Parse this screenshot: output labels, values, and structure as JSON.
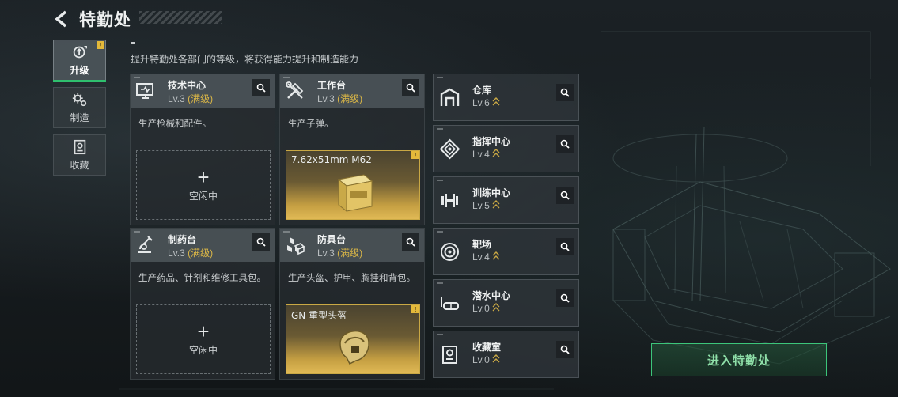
{
  "header": {
    "title": "特勤处"
  },
  "nav": [
    {
      "label": "升级",
      "icon": "upgrade-icon",
      "active": true,
      "badge": "!"
    },
    {
      "label": "制造",
      "icon": "gears-icon",
      "active": false
    },
    {
      "label": "收藏",
      "icon": "collection-icon",
      "active": false
    }
  ],
  "description": "提升特勤处各部门的等级，将获得能力提升和制造能力",
  "cards": [
    {
      "name": "技术中心",
      "level": "Lv.3",
      "max": "(满级)",
      "desc": "生产枪械和配件。",
      "icon": "tech-center-icon",
      "slot": {
        "type": "idle",
        "label": "空闲中"
      }
    },
    {
      "name": "工作台",
      "level": "Lv.3",
      "max": "(满级)",
      "desc": "生产子弹。",
      "icon": "workbench-icon",
      "slot": {
        "type": "item",
        "item": "7.62x51mm M62",
        "badge": "!"
      }
    },
    {
      "name": "制药台",
      "level": "Lv.3",
      "max": "(满级)",
      "desc": "生产药品、针剂和维修工具包。",
      "icon": "pharmacy-icon",
      "slot": {
        "type": "idle",
        "label": "空闲中"
      }
    },
    {
      "name": "防具台",
      "level": "Lv.3",
      "max": "(满级)",
      "desc": "生产头盔、护甲、胸挂和背包。",
      "icon": "armor-bench-icon",
      "slot": {
        "type": "item",
        "item": "GN 重型头盔",
        "badge": "!"
      }
    }
  ],
  "facilities": [
    {
      "name": "仓库",
      "level": "Lv.6",
      "icon": "warehouse-icon"
    },
    {
      "name": "指挥中心",
      "level": "Lv.4",
      "icon": "command-center-icon"
    },
    {
      "name": "训练中心",
      "level": "Lv.5",
      "icon": "dumbbell-icon"
    },
    {
      "name": "靶场",
      "level": "Lv.4",
      "icon": "target-icon"
    },
    {
      "name": "潜水中心",
      "level": "Lv.0",
      "icon": "diving-mask-icon"
    },
    {
      "name": "收藏室",
      "level": "Lv.0",
      "icon": "collection-room-icon"
    }
  ],
  "enter_button": "进入特勤处",
  "colors": {
    "accent_green": "#3cc57a",
    "max_level_gold": "#d8b547",
    "badge_yellow": "#e4b93a"
  }
}
